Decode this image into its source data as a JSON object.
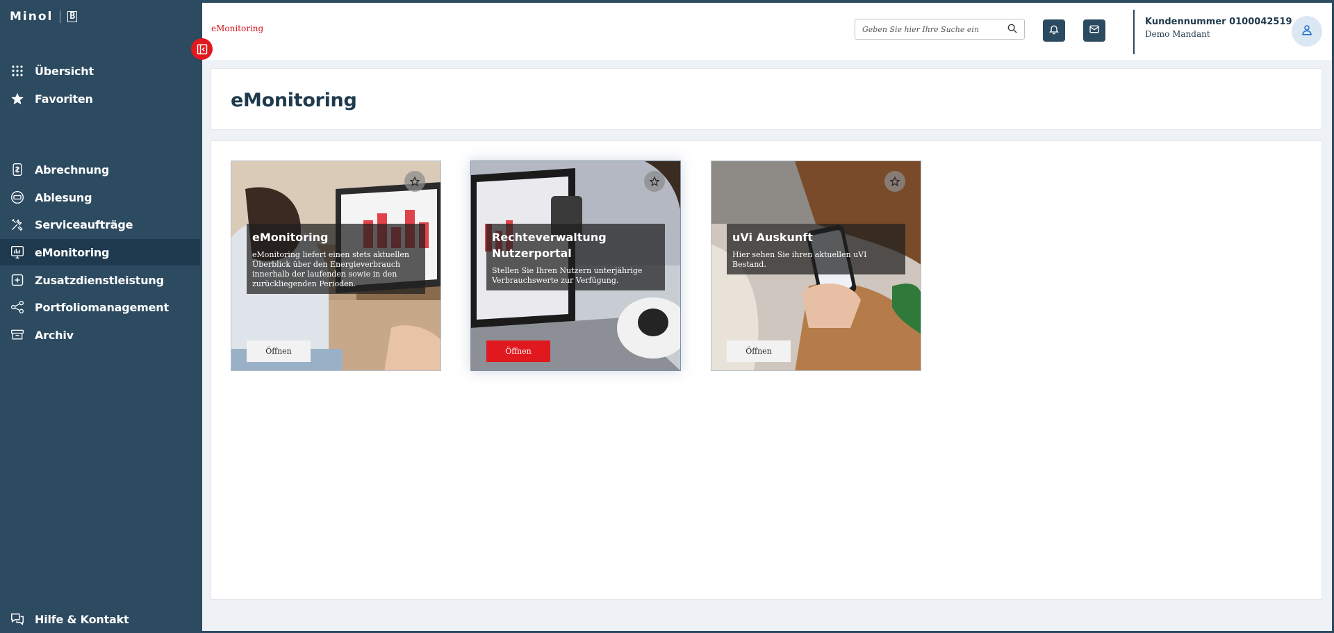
{
  "sidebar": {
    "brand": "Minol",
    "brand_mark": "B",
    "top_items": [
      {
        "label": "Übersicht",
        "icon": "grid-icon"
      },
      {
        "label": "Favoriten",
        "icon": "star-icon"
      }
    ],
    "items": [
      {
        "label": "Abrechnung",
        "icon": "bill-icon"
      },
      {
        "label": "Ablesung",
        "icon": "meter-icon"
      },
      {
        "label": "Serviceaufträge",
        "icon": "tools-icon"
      },
      {
        "label": "eMonitoring",
        "icon": "chart-icon",
        "active": true
      },
      {
        "label": "Zusatzdienstleistung",
        "icon": "plus-box-icon"
      },
      {
        "label": "Portfoliomanagement",
        "icon": "share-icon"
      },
      {
        "label": "Archiv",
        "icon": "archive-icon"
      }
    ],
    "help_label": "Hilfe & Kontakt"
  },
  "topbar": {
    "breadcrumb": "eMonitoring",
    "search_placeholder": "Geben Sie hier Ihre Suche ein",
    "customer_number": "Kundennummer 0100042519",
    "mandant": "Demo Mandant"
  },
  "page": {
    "title": "eMonitoring"
  },
  "tiles": [
    {
      "title": "eMonitoring",
      "description": "eMonitoring liefert einen stets aktuellen Überblick über den Energieverbrauch innerhalb der laufenden sowie in den zurückliegenden Perioden.",
      "button": "Öffnen",
      "highlighted": false
    },
    {
      "title": "Rechteverwaltung Nutzerportal",
      "description": "Stellen Sie Ihren Nutzern unterjährige Verbrauchswerte zur Verfügung.",
      "button": "Öffnen",
      "highlighted": true
    },
    {
      "title": "uVi Auskunft",
      "description": "Hier sehen Sie ihren aktuellen uVI Bestand.",
      "button": "Öffnen",
      "highlighted": false
    }
  ],
  "colors": {
    "sidebar": "#2c4a60",
    "accent_red": "#e0191f",
    "text_dark": "#1f3a4d"
  }
}
